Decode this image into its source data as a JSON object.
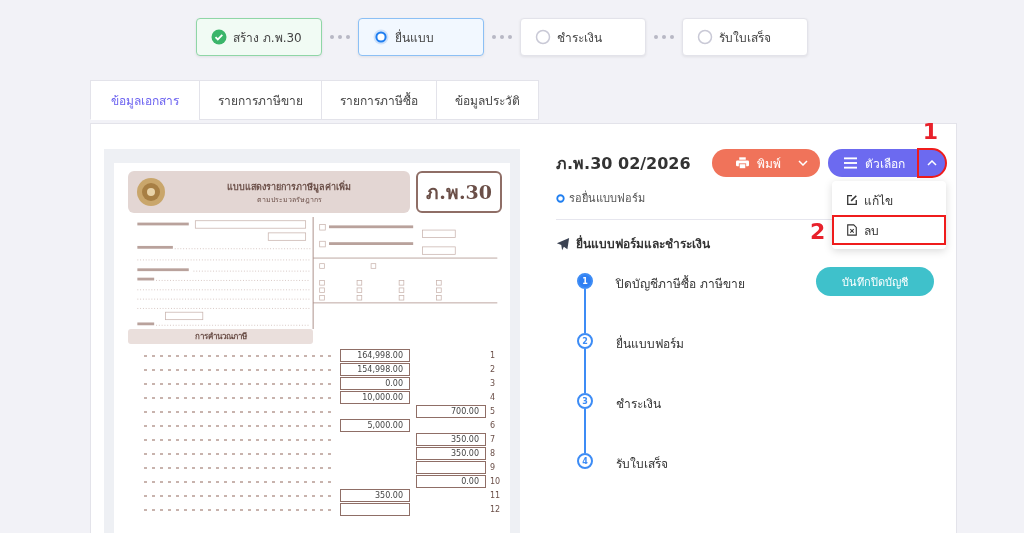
{
  "stepper": [
    {
      "label": "สร้าง ภ.พ.30",
      "kind": "done"
    },
    {
      "label": "ยื่นแบบ",
      "kind": "current"
    },
    {
      "label": "ชำระเงิน",
      "kind": "todo"
    },
    {
      "label": "รับใบเสร็จ",
      "kind": "todo"
    }
  ],
  "tabs": [
    {
      "label": "ข้อมูลเอกสาร",
      "selected": true
    },
    {
      "label": "รายการภาษีขาย",
      "selected": false
    },
    {
      "label": "รายการภาษีซื้อ",
      "selected": false
    },
    {
      "label": "ข้อมูลประวัติ",
      "selected": false
    }
  ],
  "document": {
    "title": "แบบแสดงรายการภาษีมูลค่าเพิ่ม",
    "subtitle": "ตามประมวลรัษฎากร",
    "code": "ภ.พ.30",
    "section": "การคำนวณภาษี",
    "rows": [
      {
        "no": "1",
        "kind": "left",
        "amount": "164,998.00"
      },
      {
        "no": "2",
        "kind": "left",
        "amount": "154,998.00"
      },
      {
        "no": "3",
        "kind": "left",
        "amount": "0.00"
      },
      {
        "no": "4",
        "kind": "left",
        "amount": "10,000.00"
      },
      {
        "no": "5",
        "kind": "right",
        "amount": "700.00"
      },
      {
        "no": "6",
        "kind": "left",
        "amount": "5,000.00"
      },
      {
        "no": "7",
        "kind": "right",
        "amount": "350.00"
      },
      {
        "no": "8",
        "kind": "right",
        "amount": "350.00"
      },
      {
        "no": "9",
        "kind": "right"
      },
      {
        "no": "10",
        "kind": "right",
        "amount": "0.00"
      },
      {
        "no": "11",
        "kind": "left",
        "amount": "350.00"
      },
      {
        "no": "12",
        "kind": "left"
      }
    ]
  },
  "header": {
    "title": "ภ.พ.30 02/2026",
    "status": "รอยื่นแบบฟอร์ม"
  },
  "print_button": {
    "label": "พิมพ์"
  },
  "options_button": {
    "label": "ตัวเลือก",
    "expanded": true
  },
  "options_menu": [
    {
      "label": "แก้ไข",
      "kind": "edit",
      "highlighted": false
    },
    {
      "label": "ลบ",
      "kind": "delete",
      "highlighted": true
    }
  ],
  "annotations": [
    "1",
    "2"
  ],
  "process": {
    "title": "ยื่นแบบฟอร์มและชำระเงิน",
    "steps": [
      {
        "number": "1",
        "label": "ปิดบัญชีภาษีซื้อ ภาษีขาย",
        "selected": true,
        "action": "บันทึกปิดบัญชี"
      },
      {
        "number": "2",
        "label": "ยื่นแบบฟอร์ม",
        "selected": false
      },
      {
        "number": "3",
        "label": "ชำระเงิน",
        "selected": false
      },
      {
        "number": "4",
        "label": "รับใบเสร็จ",
        "selected": false
      }
    ]
  }
}
